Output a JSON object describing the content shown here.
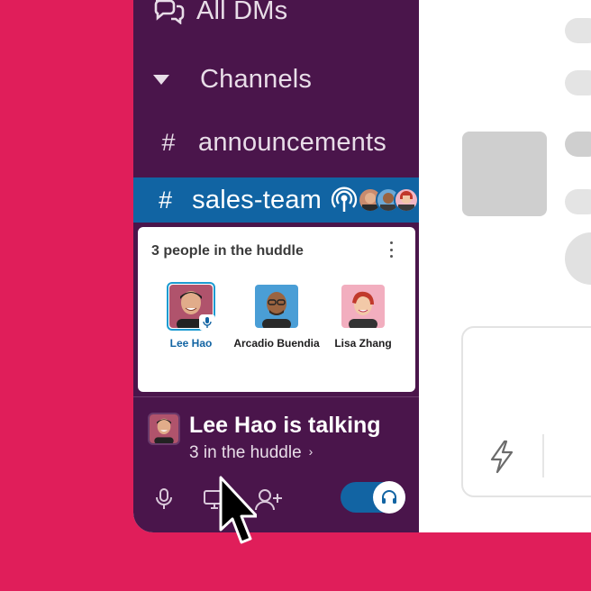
{
  "sidebar": {
    "all_dms_label": "All DMs",
    "channels_label": "Channels",
    "channels": [
      {
        "hash": "#",
        "name": "announcements"
      },
      {
        "hash": "#",
        "name": "sales-team"
      }
    ]
  },
  "huddle": {
    "title": "3 people in the huddle",
    "participants": [
      {
        "name": "Lee Hao",
        "speaking": true
      },
      {
        "name": "Arcadio Buendia",
        "speaking": false
      },
      {
        "name": "Lisa Zhang",
        "speaking": false
      }
    ],
    "talking_title": "Lee Hao is talking",
    "talking_sub": "3 in the huddle",
    "chevron": "›"
  },
  "controls": {
    "icons": [
      "microphone-icon",
      "screen-share-icon",
      "add-person-icon",
      "headphones-icon"
    ],
    "headphones_on": true
  },
  "colors": {
    "background": "#e01e5a",
    "sidebar": "#4a154b",
    "selected": "#1164a3",
    "toggle": "#1264a3"
  }
}
